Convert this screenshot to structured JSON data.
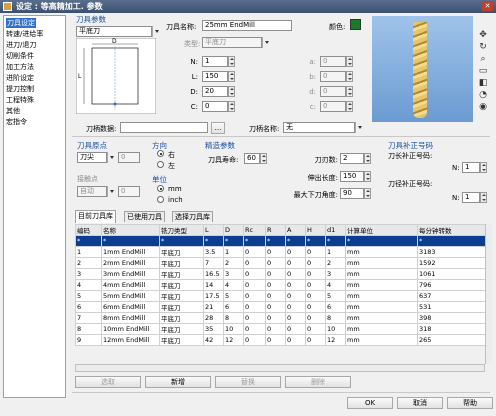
{
  "window": {
    "title": "设定 : 等高精加工. 参数",
    "close": "✕"
  },
  "nav": {
    "items": [
      "刀具设定",
      "转速/进给率",
      "进刀/退刀",
      "切削条件",
      "加工方法",
      "进阶设定",
      "提刀控制",
      "工程特殊",
      "其他",
      "宏指令"
    ],
    "selected_index": 0
  },
  "tool_params": {
    "group_label": "刀具参数",
    "type_value": "平底刀",
    "name_label": "刀具名称:",
    "name_value": "25mm EndMill",
    "color_label": "颜色:",
    "color": "#1a7a2a",
    "kind_label": "类型:",
    "kind_value": "平底刀",
    "fields_left": [
      {
        "label": "N:",
        "value": "1"
      },
      {
        "label": "L:",
        "value": "150"
      },
      {
        "label": "D:",
        "value": "20"
      },
      {
        "label": "C:",
        "value": "0"
      }
    ],
    "fields_right": [
      {
        "label": "a:",
        "value": "0"
      },
      {
        "label": "b:",
        "value": "0"
      },
      {
        "label": "d:",
        "value": "0"
      },
      {
        "label": "c:",
        "value": "0"
      }
    ],
    "holder_data_label": "刀柄数据:",
    "holder_data_value": "",
    "browse": "...",
    "holder_name_label": "刀柄名称:",
    "holder_name_value": "无",
    "diagram_labels": {
      "D": "D",
      "L": "L"
    }
  },
  "origin": {
    "group_label": "刀具原点",
    "origin_value": "刀尖",
    "origin_num": "0",
    "contact_label": "接触点",
    "contact_value": "自动",
    "contact_num": "0"
  },
  "direction": {
    "group_label": "方向",
    "right": "右",
    "left": "左",
    "unit_label": "单位",
    "mm": "mm",
    "inch": "inch"
  },
  "precision": {
    "group_label": "精造参数",
    "life_label": "刀具寿命:",
    "life_value": "60",
    "flutes_label": "刀刃数:",
    "flutes_value": "2",
    "extension_label": "伸出长度:",
    "extension_value": "150",
    "angle_label": "最大下刀角度:",
    "angle_value": "90"
  },
  "compensation": {
    "group_label": "刀具补正号码",
    "length_label": "刀长补正号码:",
    "length_n": "N:",
    "length_value": "1",
    "radius_label": "刀径补正号码:",
    "radius_n": "N:",
    "radius_value": "1"
  },
  "library": {
    "tabs": [
      "目前刀具库",
      "已使用刀具",
      "选择刀具库"
    ],
    "columns": [
      "编码",
      "名称",
      "铣刀类型",
      "L",
      "D",
      "Rc",
      "R",
      "A",
      "H",
      "d1",
      "计算单位",
      "每分钟转数"
    ],
    "filter_row": [
      "*",
      "*",
      "*",
      "*",
      "*",
      "*",
      "*",
      "*",
      "*",
      "*",
      "*",
      "*"
    ],
    "rows": [
      [
        "1",
        "1mm EndMill",
        "平底刀",
        "3.5",
        "1",
        "0",
        "0",
        "0",
        "0",
        "1",
        "mm",
        "3183"
      ],
      [
        "2",
        "2mm EndMill",
        "平底刀",
        "7",
        "2",
        "0",
        "0",
        "0",
        "0",
        "2",
        "mm",
        "1592"
      ],
      [
        "3",
        "3mm EndMill",
        "平底刀",
        "16.5",
        "3",
        "0",
        "0",
        "0",
        "0",
        "3",
        "mm",
        "1061"
      ],
      [
        "4",
        "4mm EndMill",
        "平底刀",
        "14",
        "4",
        "0",
        "0",
        "0",
        "0",
        "4",
        "mm",
        "796"
      ],
      [
        "5",
        "5mm EndMill",
        "平底刀",
        "17.5",
        "5",
        "0",
        "0",
        "0",
        "0",
        "5",
        "mm",
        "637"
      ],
      [
        "6",
        "6mm EndMill",
        "平底刀",
        "21",
        "6",
        "0",
        "0",
        "0",
        "0",
        "6",
        "mm",
        "531"
      ],
      [
        "7",
        "8mm EndMill",
        "平底刀",
        "28",
        "8",
        "0",
        "0",
        "0",
        "0",
        "8",
        "mm",
        "398"
      ],
      [
        "8",
        "10mm EndMill",
        "平底刀",
        "35",
        "10",
        "0",
        "0",
        "0",
        "0",
        "10",
        "mm",
        "318"
      ],
      [
        "9",
        "12mm EndMill",
        "平底刀",
        "42",
        "12",
        "0",
        "0",
        "0",
        "0",
        "12",
        "mm",
        "265"
      ]
    ],
    "buttons": [
      "选取",
      "新增",
      "替换",
      "删除"
    ]
  },
  "footer": {
    "ok": "OK",
    "cancel": "取消",
    "help": "帮助"
  }
}
